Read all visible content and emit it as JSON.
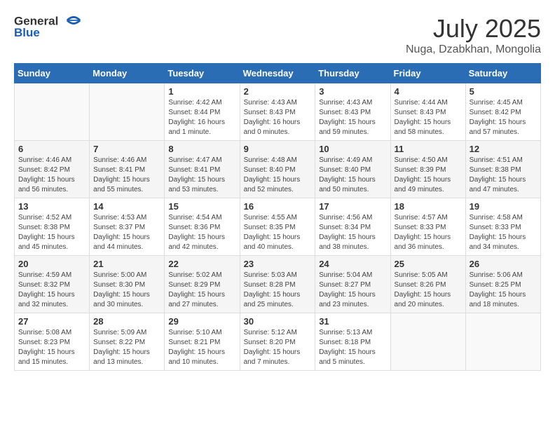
{
  "header": {
    "logo_general": "General",
    "logo_blue": "Blue",
    "month_year": "July 2025",
    "location": "Nuga, Dzabkhan, Mongolia"
  },
  "days_of_week": [
    "Sunday",
    "Monday",
    "Tuesday",
    "Wednesday",
    "Thursday",
    "Friday",
    "Saturday"
  ],
  "weeks": [
    [
      {
        "day": "",
        "info": ""
      },
      {
        "day": "",
        "info": ""
      },
      {
        "day": "1",
        "info": "Sunrise: 4:42 AM\nSunset: 8:44 PM\nDaylight: 16 hours\nand 1 minute."
      },
      {
        "day": "2",
        "info": "Sunrise: 4:43 AM\nSunset: 8:43 PM\nDaylight: 16 hours\nand 0 minutes."
      },
      {
        "day": "3",
        "info": "Sunrise: 4:43 AM\nSunset: 8:43 PM\nDaylight: 15 hours\nand 59 minutes."
      },
      {
        "day": "4",
        "info": "Sunrise: 4:44 AM\nSunset: 8:43 PM\nDaylight: 15 hours\nand 58 minutes."
      },
      {
        "day": "5",
        "info": "Sunrise: 4:45 AM\nSunset: 8:42 PM\nDaylight: 15 hours\nand 57 minutes."
      }
    ],
    [
      {
        "day": "6",
        "info": "Sunrise: 4:46 AM\nSunset: 8:42 PM\nDaylight: 15 hours\nand 56 minutes."
      },
      {
        "day": "7",
        "info": "Sunrise: 4:46 AM\nSunset: 8:41 PM\nDaylight: 15 hours\nand 55 minutes."
      },
      {
        "day": "8",
        "info": "Sunrise: 4:47 AM\nSunset: 8:41 PM\nDaylight: 15 hours\nand 53 minutes."
      },
      {
        "day": "9",
        "info": "Sunrise: 4:48 AM\nSunset: 8:40 PM\nDaylight: 15 hours\nand 52 minutes."
      },
      {
        "day": "10",
        "info": "Sunrise: 4:49 AM\nSunset: 8:40 PM\nDaylight: 15 hours\nand 50 minutes."
      },
      {
        "day": "11",
        "info": "Sunrise: 4:50 AM\nSunset: 8:39 PM\nDaylight: 15 hours\nand 49 minutes."
      },
      {
        "day": "12",
        "info": "Sunrise: 4:51 AM\nSunset: 8:38 PM\nDaylight: 15 hours\nand 47 minutes."
      }
    ],
    [
      {
        "day": "13",
        "info": "Sunrise: 4:52 AM\nSunset: 8:38 PM\nDaylight: 15 hours\nand 45 minutes."
      },
      {
        "day": "14",
        "info": "Sunrise: 4:53 AM\nSunset: 8:37 PM\nDaylight: 15 hours\nand 44 minutes."
      },
      {
        "day": "15",
        "info": "Sunrise: 4:54 AM\nSunset: 8:36 PM\nDaylight: 15 hours\nand 42 minutes."
      },
      {
        "day": "16",
        "info": "Sunrise: 4:55 AM\nSunset: 8:35 PM\nDaylight: 15 hours\nand 40 minutes."
      },
      {
        "day": "17",
        "info": "Sunrise: 4:56 AM\nSunset: 8:34 PM\nDaylight: 15 hours\nand 38 minutes."
      },
      {
        "day": "18",
        "info": "Sunrise: 4:57 AM\nSunset: 8:33 PM\nDaylight: 15 hours\nand 36 minutes."
      },
      {
        "day": "19",
        "info": "Sunrise: 4:58 AM\nSunset: 8:33 PM\nDaylight: 15 hours\nand 34 minutes."
      }
    ],
    [
      {
        "day": "20",
        "info": "Sunrise: 4:59 AM\nSunset: 8:32 PM\nDaylight: 15 hours\nand 32 minutes."
      },
      {
        "day": "21",
        "info": "Sunrise: 5:00 AM\nSunset: 8:30 PM\nDaylight: 15 hours\nand 30 minutes."
      },
      {
        "day": "22",
        "info": "Sunrise: 5:02 AM\nSunset: 8:29 PM\nDaylight: 15 hours\nand 27 minutes."
      },
      {
        "day": "23",
        "info": "Sunrise: 5:03 AM\nSunset: 8:28 PM\nDaylight: 15 hours\nand 25 minutes."
      },
      {
        "day": "24",
        "info": "Sunrise: 5:04 AM\nSunset: 8:27 PM\nDaylight: 15 hours\nand 23 minutes."
      },
      {
        "day": "25",
        "info": "Sunrise: 5:05 AM\nSunset: 8:26 PM\nDaylight: 15 hours\nand 20 minutes."
      },
      {
        "day": "26",
        "info": "Sunrise: 5:06 AM\nSunset: 8:25 PM\nDaylight: 15 hours\nand 18 minutes."
      }
    ],
    [
      {
        "day": "27",
        "info": "Sunrise: 5:08 AM\nSunset: 8:23 PM\nDaylight: 15 hours\nand 15 minutes."
      },
      {
        "day": "28",
        "info": "Sunrise: 5:09 AM\nSunset: 8:22 PM\nDaylight: 15 hours\nand 13 minutes."
      },
      {
        "day": "29",
        "info": "Sunrise: 5:10 AM\nSunset: 8:21 PM\nDaylight: 15 hours\nand 10 minutes."
      },
      {
        "day": "30",
        "info": "Sunrise: 5:12 AM\nSunset: 8:20 PM\nDaylight: 15 hours\nand 7 minutes."
      },
      {
        "day": "31",
        "info": "Sunrise: 5:13 AM\nSunset: 8:18 PM\nDaylight: 15 hours\nand 5 minutes."
      },
      {
        "day": "",
        "info": ""
      },
      {
        "day": "",
        "info": ""
      }
    ]
  ]
}
